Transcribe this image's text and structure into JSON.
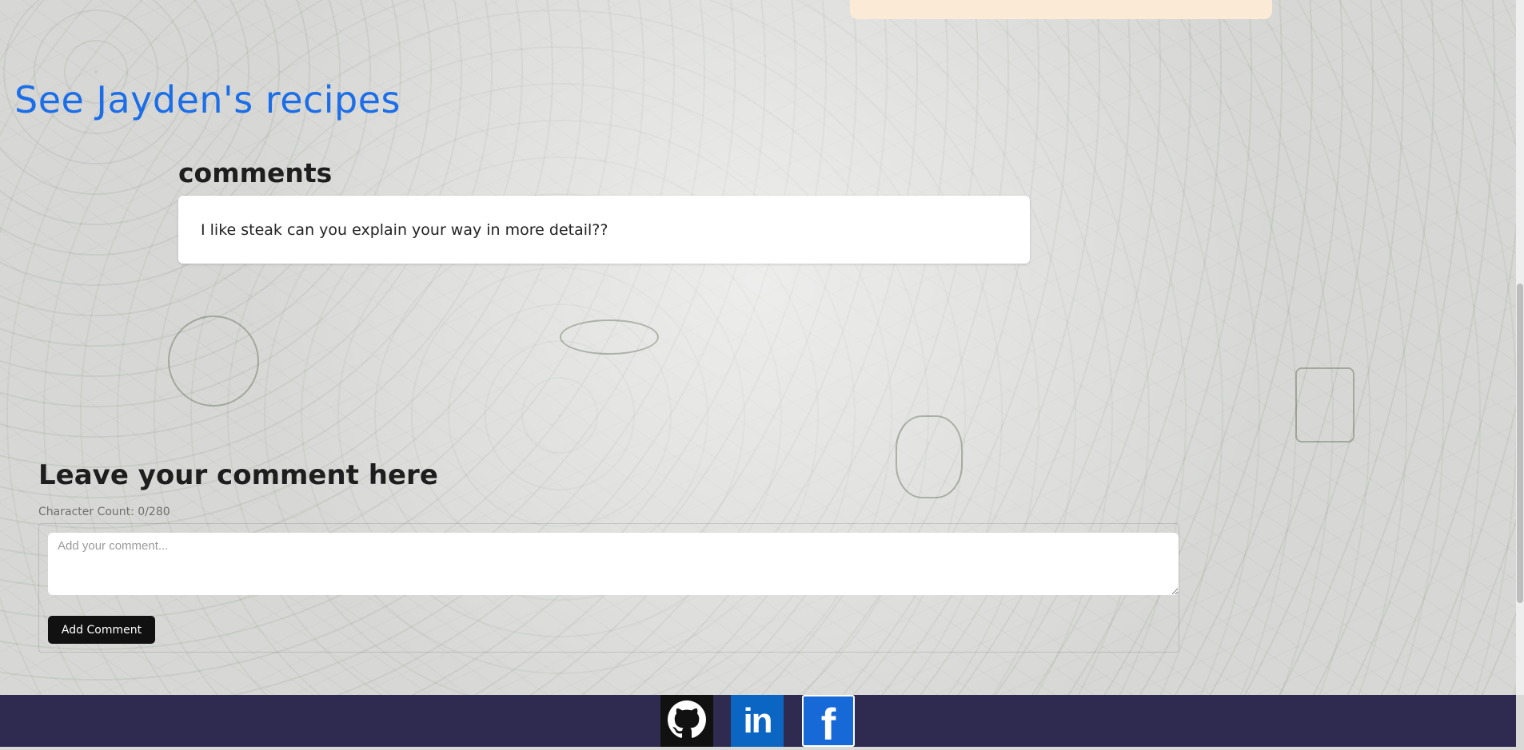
{
  "top_card": {},
  "recipes_link": "See Jayden's recipes",
  "comments": {
    "heading": "comments",
    "items": [
      {
        "text": "I like steak can you explain your way in more detail??"
      }
    ]
  },
  "comment_form": {
    "heading": "Leave your comment here",
    "char_count": "Character Count: 0/280",
    "placeholder": "Add your comment...",
    "value": "",
    "submit_label": "Add Comment"
  },
  "footer": {
    "links": [
      {
        "name": "github",
        "icon": "github-icon",
        "color": "#111111"
      },
      {
        "name": "linkedin",
        "icon": "linkedin-icon",
        "glyph": "in",
        "color": "#0a66c2"
      },
      {
        "name": "facebook",
        "icon": "facebook-icon",
        "glyph": "f",
        "color": "#1769d8"
      }
    ],
    "background": "#2f2a4f"
  },
  "colors": {
    "link": "#1c6ee8",
    "button": "#111111",
    "top_card": "#fbead6"
  }
}
